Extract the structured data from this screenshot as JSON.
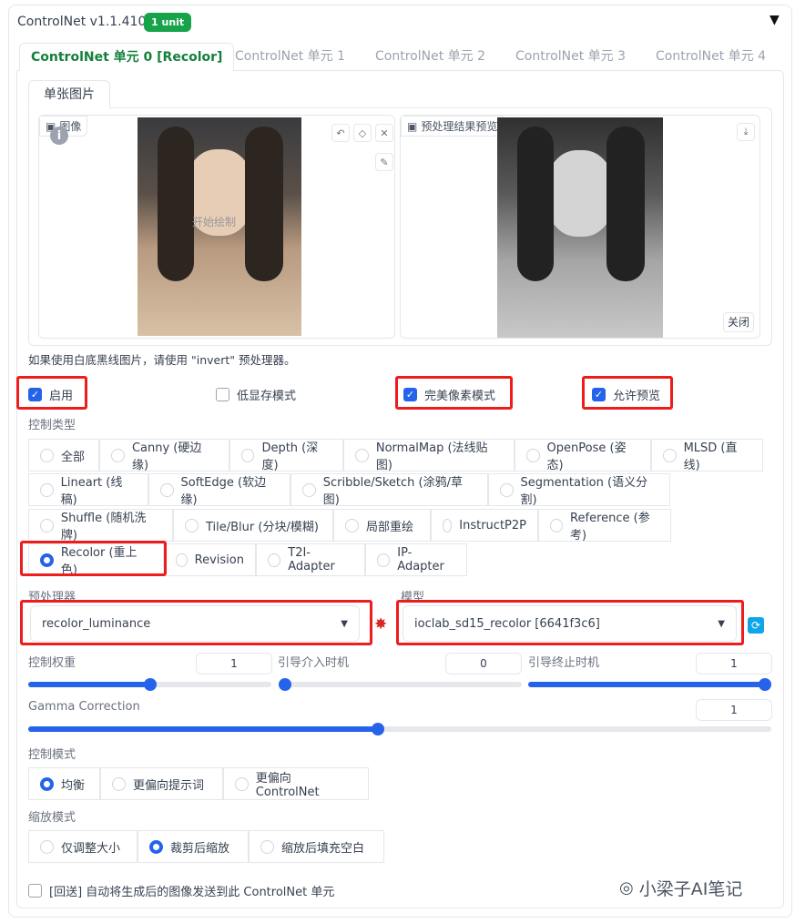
{
  "header": {
    "title": "ControlNet v1.1.410",
    "badge": "1 unit",
    "collapse_icon": "▼"
  },
  "tabs": [
    {
      "label": "ControlNet 单元 0 [Recolor]"
    },
    {
      "label": "ControlNet 单元 1"
    },
    {
      "label": "ControlNet 单元 2"
    },
    {
      "label": "ControlNet 单元 3"
    },
    {
      "label": "ControlNet 单元 4"
    }
  ],
  "subtab": "单张图片",
  "image_input": {
    "label": "图像",
    "overlay_text": "开始绘制"
  },
  "preview": {
    "label": "预处理结果预览",
    "close_label": "关闭"
  },
  "note": "如果使用白底黑线图片，请使用 \"invert\" 预处理器。",
  "checkboxes": {
    "enable": {
      "label": "启用",
      "checked": true
    },
    "low_vram": {
      "label": "低显存模式",
      "checked": false
    },
    "pixel_perfect": {
      "label": "完美像素模式",
      "checked": true
    },
    "allow_preview": {
      "label": "允许预览",
      "checked": true
    }
  },
  "control_type": {
    "label": "控制类型",
    "options": [
      "全部",
      "Canny (硬边缘)",
      "Depth (深度)",
      "NormalMap (法线贴图)",
      "OpenPose (姿态)",
      "MLSD (直线)",
      "Lineart (线稿)",
      "SoftEdge (软边缘)",
      "Scribble/Sketch (涂鸦/草图)",
      "Segmentation (语义分割)",
      "Shuffle (随机洗牌)",
      "Tile/Blur (分块/模糊)",
      "局部重绘",
      "InstructP2P",
      "Reference (参考)",
      "Recolor (重上色)",
      "Revision",
      "T2I-Adapter",
      "IP-Adapter"
    ],
    "selected": "Recolor (重上色)"
  },
  "preprocessor": {
    "label": "预处理器",
    "value": "recolor_luminance"
  },
  "model": {
    "label": "模型",
    "value": "ioclab_sd15_recolor [6641f3c6]"
  },
  "sliders": {
    "weight": {
      "label": "控制权重",
      "value": "1",
      "fraction": 0.5
    },
    "start": {
      "label": "引导介入时机",
      "value": "0",
      "fraction": 0.0
    },
    "end": {
      "label": "引导终止时机",
      "value": "1",
      "fraction": 1.0
    },
    "gamma": {
      "label": "Gamma Correction",
      "value": "1",
      "fraction": 0.47
    }
  },
  "control_mode": {
    "label": "控制模式",
    "options": [
      "均衡",
      "更偏向提示词",
      "更偏向 ControlNet"
    ],
    "selected": "均衡"
  },
  "resize_mode": {
    "label": "缩放模式",
    "options": [
      "仅调整大小",
      "裁剪后缩放",
      "缩放后填充空白"
    ],
    "selected": "裁剪后缩放"
  },
  "loopback": {
    "label": "[回送] 自动将生成后的图像发送到此 ControlNet 单元",
    "checked": false
  },
  "watermark": "小梁子AI笔记",
  "colors": {
    "accent": "#2563eb",
    "green": "#16a34a",
    "highlight": "#ef1c1c"
  }
}
